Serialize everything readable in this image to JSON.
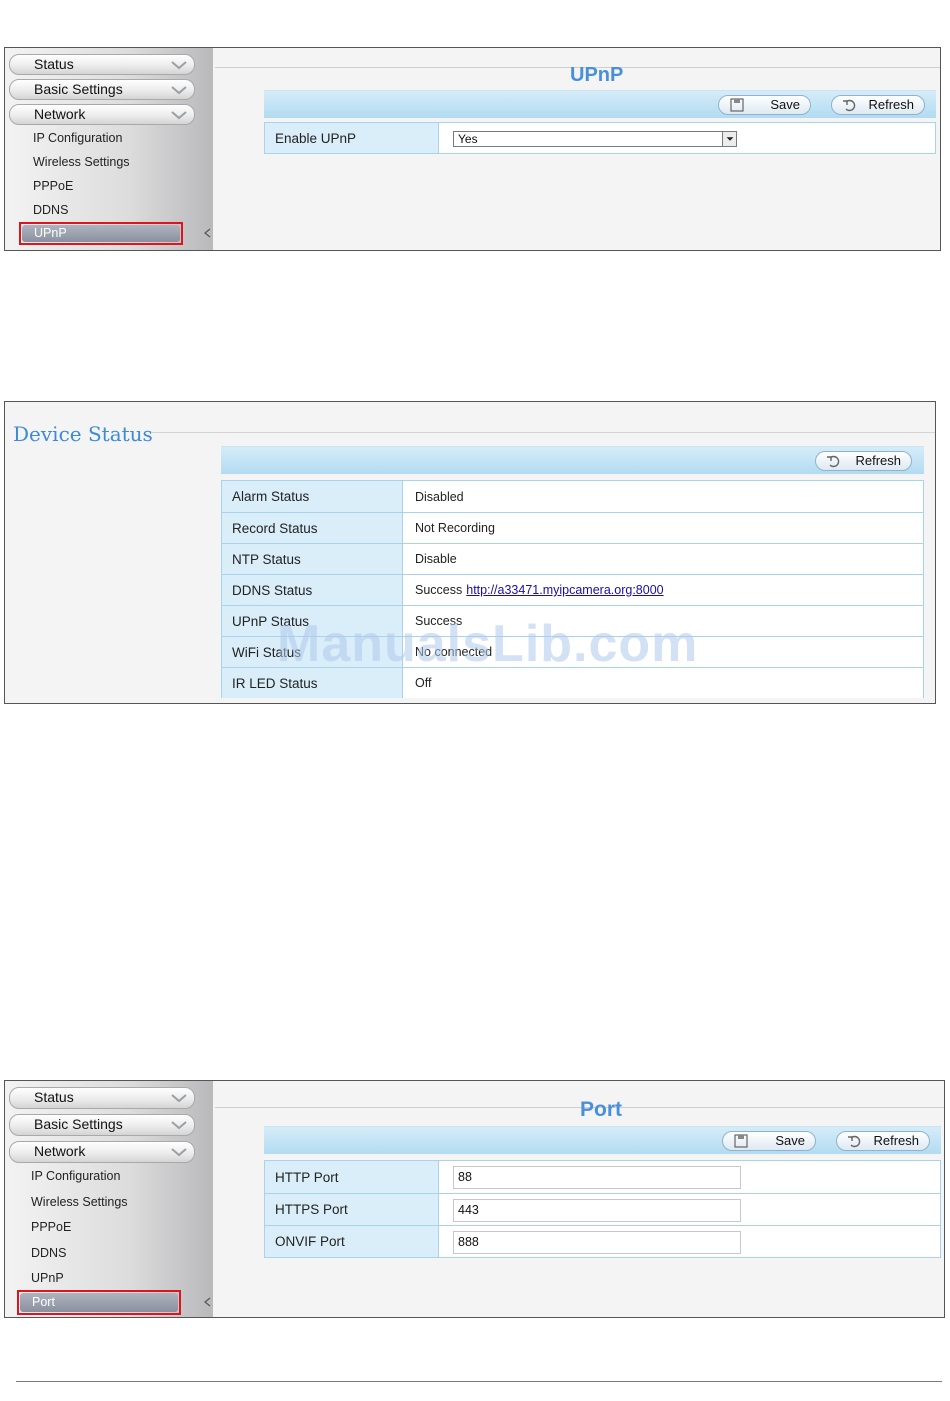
{
  "upnp_panel": {
    "sidebar": {
      "menus": [
        "Status",
        "Basic Settings",
        "Network"
      ],
      "submenu": [
        "IP Configuration",
        "Wireless Settings",
        "PPPoE",
        "DDNS"
      ],
      "selected": "UPnP"
    },
    "title": "UPnP",
    "buttons": {
      "save": "Save",
      "refresh": "Refresh"
    },
    "field": {
      "label": "Enable UPnP",
      "value": "Yes"
    }
  },
  "device_status": {
    "title": "Device Status",
    "refresh": "Refresh",
    "rows": [
      {
        "label": "Alarm Status",
        "value": "Disabled"
      },
      {
        "label": "Record Status",
        "value": "Not Recording"
      },
      {
        "label": "NTP Status",
        "value": "Disable"
      },
      {
        "label": "DDNS Status",
        "value": "Success",
        "link": "http://a33471.myipcamera.org:8000"
      },
      {
        "label": "UPnP Status",
        "value": "Success"
      },
      {
        "label": "WiFi Status",
        "value": "No connected"
      },
      {
        "label": "IR LED Status",
        "value": "Off"
      }
    ],
    "watermark": "ManualsLib.com"
  },
  "port_panel": {
    "sidebar": {
      "menus": [
        "Status",
        "Basic Settings",
        "Network"
      ],
      "submenu": [
        "IP Configuration",
        "Wireless Settings",
        "PPPoE",
        "DDNS",
        "UPnP"
      ],
      "selected": "Port"
    },
    "title": "Port",
    "buttons": {
      "save": "Save",
      "refresh": "Refresh"
    },
    "fields": [
      {
        "label": "HTTP Port",
        "value": "88"
      },
      {
        "label": "HTTPS Port",
        "value": "443"
      },
      {
        "label": "ONVIF Port",
        "value": "888"
      }
    ]
  },
  "icons": [
    "chevron-down-icon",
    "save-icon",
    "refresh-icon",
    "dropdown-arrow-icon",
    "collapse-arrow-icon"
  ],
  "colors": {
    "title_blue": "#4a90d9",
    "toolbar_blue": "#b2dbf1",
    "label_bg": "#daeefa",
    "highlight_red": "#e0141e"
  }
}
